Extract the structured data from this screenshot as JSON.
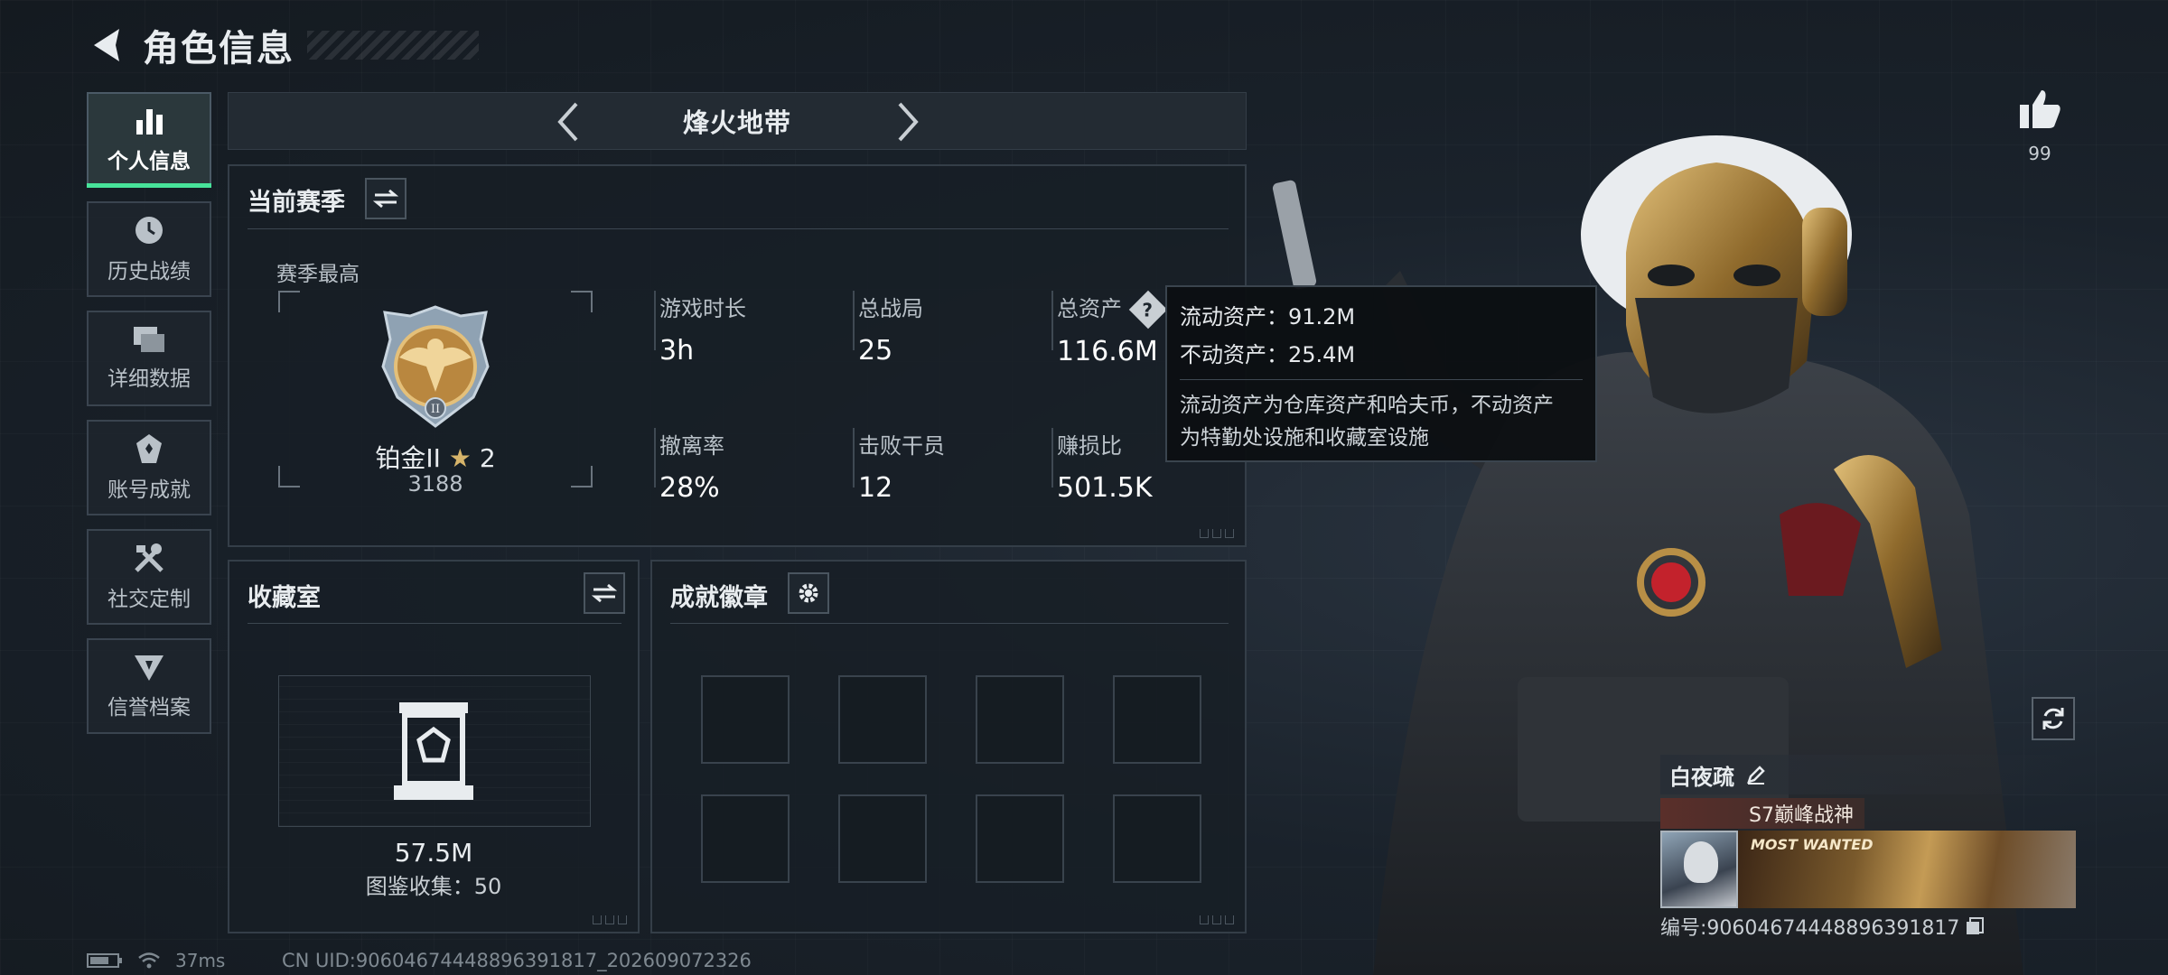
{
  "header": {
    "title": "角色信息"
  },
  "sidebar": {
    "items": [
      {
        "label": "个人信息",
        "icon": "bar-chart-icon",
        "active": true
      },
      {
        "label": "历史战绩",
        "icon": "history-icon"
      },
      {
        "label": "详细数据",
        "icon": "data-cards-icon"
      },
      {
        "label": "账号成就",
        "icon": "achievement-icon"
      },
      {
        "label": "社交定制",
        "icon": "tools-icon"
      },
      {
        "label": "信誉档案",
        "icon": "reputation-icon"
      }
    ]
  },
  "season_bar": {
    "name": "烽火地带"
  },
  "current_season": {
    "title": "当前赛季",
    "best_label": "赛季最高",
    "rank_name": "铂金II",
    "rank_stars": "2",
    "rank_score": "3188",
    "stats": [
      {
        "label": "游戏时长",
        "value": "3h"
      },
      {
        "label": "总战局",
        "value": "25"
      },
      {
        "label": "总资产",
        "value": "116.6M"
      },
      {
        "label": "撤离率",
        "value": "28%"
      },
      {
        "label": "击败干员",
        "value": "12"
      },
      {
        "label": "赚损比",
        "value": "501.5K"
      }
    ]
  },
  "tooltip": {
    "liquid": "流动资产：91.2M",
    "fixed": "不动资产：25.4M",
    "desc_line1": "流动资产为仓库资产和哈夫币，不动资产",
    "desc_line2": "为特勤处设施和收藏室设施"
  },
  "collection": {
    "title": "收藏室",
    "value": "57.5M",
    "sub": "图鉴收集：50"
  },
  "achievements": {
    "title": "成就徽章",
    "slots": 8
  },
  "likes": {
    "count": "99"
  },
  "player": {
    "name": "白夜疏",
    "title_badge": "S7巅峰战神",
    "banner_text": "MOST WANTED",
    "id_text": "编号:9060467444889639181​7"
  },
  "status": {
    "ping": "37ms",
    "uid": "CN UID:906046744488963918​17_202609072326"
  },
  "colors": {
    "accent": "#47e39a",
    "background": "#151b22",
    "panel_border": "#343e48"
  }
}
